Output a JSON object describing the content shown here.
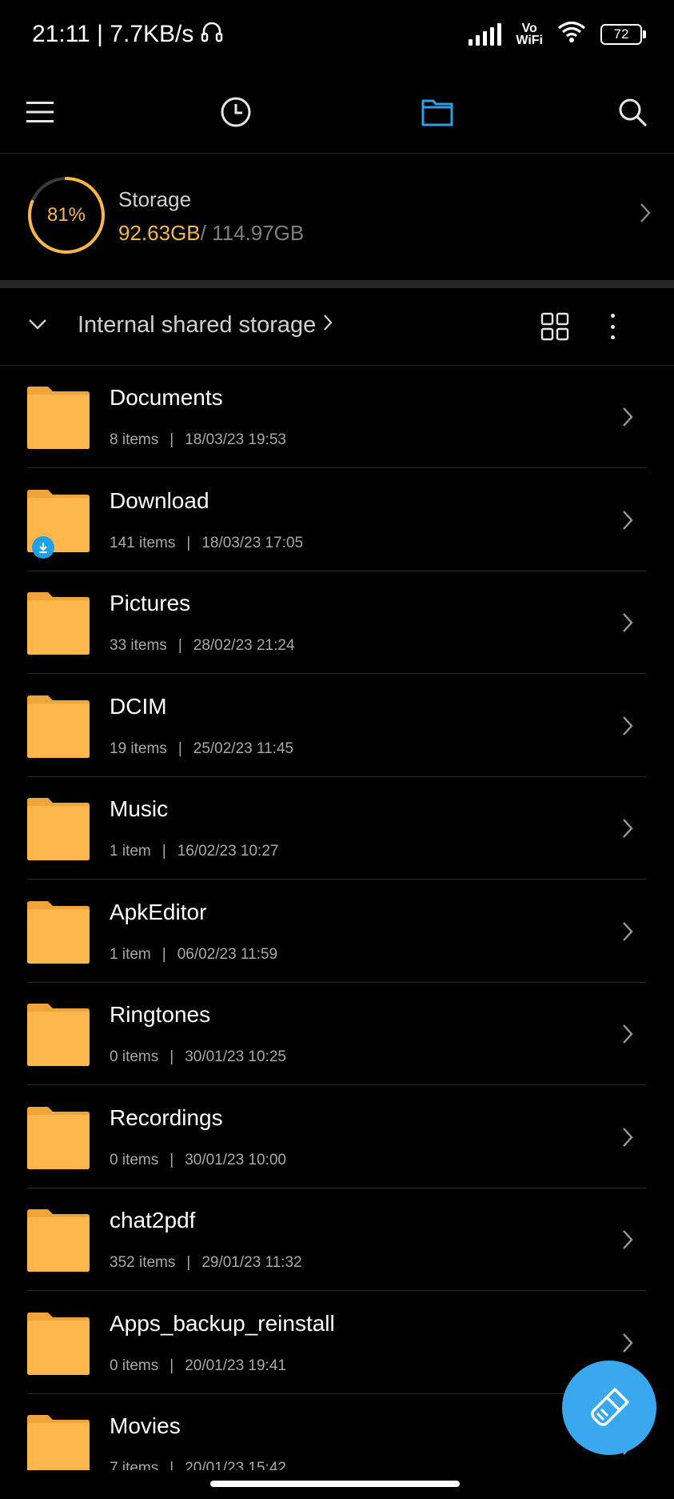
{
  "status_bar": {
    "time_speed": "21:11 | 7.7KB/s",
    "vowifi_top": "Vo",
    "vowifi_bottom": "WiFi",
    "battery": "72"
  },
  "storage": {
    "percent": "81%",
    "percent_value": 0.81,
    "title": "Storage",
    "used": "92.63GB",
    "total": "/ 114.97GB",
    "accent_color": "#f5b74a"
  },
  "path_bar": {
    "label": "Internal shared storage"
  },
  "folders": [
    {
      "name": "Documents",
      "count": "8 items",
      "date": "18/03/23 19:53"
    },
    {
      "name": "Download",
      "count": "141 items",
      "date": "18/03/23 17:05"
    },
    {
      "name": "Pictures",
      "count": "33 items",
      "date": "28/02/23 21:24"
    },
    {
      "name": "DCIM",
      "count": "19 items",
      "date": "25/02/23 11:45"
    },
    {
      "name": "Music",
      "count": "1 item",
      "date": "16/02/23 10:27"
    },
    {
      "name": "ApkEditor",
      "count": "1 item",
      "date": "06/02/23 11:59"
    },
    {
      "name": "Ringtones",
      "count": "0 items",
      "date": "30/01/23 10:25"
    },
    {
      "name": "Recordings",
      "count": "0 items",
      "date": "30/01/23 10:00"
    },
    {
      "name": "chat2pdf",
      "count": "352 items",
      "date": "29/01/23 11:32"
    },
    {
      "name": "Apps_backup_reinstall",
      "count": "0 items",
      "date": "20/01/23 19:41"
    },
    {
      "name": "Movies",
      "count": "7 items",
      "date": "20/01/23 15:42"
    }
  ],
  "colors": {
    "folder": "#fdb74d",
    "folder_tab": "#f0a43a",
    "accent_blue": "#2f9de6",
    "fab": "#3aa8ee"
  }
}
